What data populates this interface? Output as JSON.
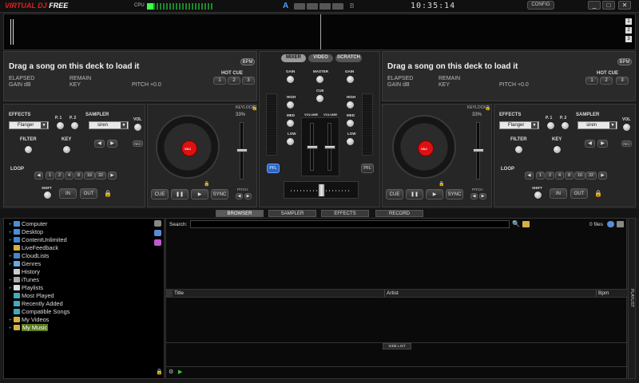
{
  "app": {
    "logo_part1": "VIRTUAL",
    "logo_part2": "DJ",
    "logo_part3": "FREE",
    "cpu_label": "CPU",
    "cpu_load": 0.1,
    "deck_a": "A",
    "deck_b": "B",
    "clock": "10:35:14",
    "config": "CONFIG",
    "min": "_",
    "max": "□",
    "close": "✕"
  },
  "wave": {
    "n1": "1",
    "n2": "2",
    "n3": "3"
  },
  "decks": [
    {
      "title": "Drag a song on this deck to load it",
      "elapsed": "ELAPSED",
      "remain": "REMAIN",
      "gain": "GAIN dB",
      "key": "KEY",
      "pitch": "PITCH +0.0",
      "bpm": "BPM",
      "hotcue": "HOT CUE",
      "hc": [
        "1",
        "2",
        "3"
      ],
      "effects": "EFFECTS",
      "effect_sel": "Flanger",
      "p1": "P. 1",
      "p2": "P. 2",
      "sampler": "SAMPLER",
      "sampler_sel": "siren",
      "vol": "VOL",
      "rec": "REC",
      "filter": "FILTER",
      "key2": "KEY",
      "loop": "LOOP",
      "loops": [
        "◀",
        "1",
        "2",
        "4",
        "8",
        "16",
        "32",
        "▶"
      ],
      "shift": "SHIFT",
      "in": "IN",
      "out": "OUT",
      "keylock": "KEYLOCK",
      "pct": "33%",
      "cue": "CUE",
      "pause": "❚❚",
      "play": "▶",
      "sync": "SYNC",
      "pitch2": "PITCH"
    },
    {
      "title": "Drag a song on this deck to load it",
      "elapsed": "ELAPSED",
      "remain": "REMAIN",
      "gain": "GAIN dB",
      "key": "KEY",
      "pitch": "PITCH +0.0",
      "bpm": "BPM",
      "hotcue": "HOT CUE",
      "hc": [
        "1",
        "2",
        "3"
      ],
      "effects": "EFFECTS",
      "effect_sel": "Flanger",
      "p1": "P. 1",
      "p2": "P. 2",
      "sampler": "SAMPLER",
      "sampler_sel": "siren",
      "vol": "VOL",
      "rec": "REC",
      "filter": "FILTER",
      "key2": "KEY",
      "loop": "LOOP",
      "loops": [
        "◀",
        "1",
        "2",
        "4",
        "8",
        "16",
        "32",
        "▶"
      ],
      "shift": "SHIFT",
      "in": "IN",
      "out": "OUT",
      "keylock": "KEYLOCK",
      "pct": "33%",
      "cue": "CUE",
      "pause": "❚❚",
      "play": "▶",
      "sync": "SYNC",
      "pitch2": "PITCH"
    }
  ],
  "mixer": {
    "tab_mixer": "MIXER",
    "tab_video": "VIDEO",
    "tab_scratch": "SCRATCH",
    "gain": "GAIN",
    "master": "MASTER",
    "cue": "CUE",
    "high": "HIGH",
    "med": "MED",
    "low": "LOW",
    "volume": "VOLUME",
    "pfl": "PFL"
  },
  "tabs": [
    "BROWSER",
    "SAMPLER",
    "EFFECTS",
    "RECORD"
  ],
  "tree": [
    {
      "label": "Computer",
      "plus": "+",
      "color": "#4a8fd6"
    },
    {
      "label": "Desktop",
      "plus": "+",
      "color": "#4a8fd6"
    },
    {
      "label": "ContentUnlimited",
      "plus": "+",
      "color": "#48c"
    },
    {
      "label": "LiveFeedback",
      "plus": "",
      "color": "#d8b040"
    },
    {
      "label": "CloudLists",
      "plus": "+",
      "color": "#48c"
    },
    {
      "label": "Genres",
      "plus": "+",
      "color": "#6ad"
    },
    {
      "label": "History",
      "plus": "",
      "color": "#ccc"
    },
    {
      "label": "iTunes",
      "plus": "+",
      "color": "#aaa"
    },
    {
      "label": "Playlists",
      "plus": "+",
      "color": "#ddd"
    },
    {
      "label": "Most Played",
      "plus": "",
      "color": "#4ab"
    },
    {
      "label": "Recently Added",
      "plus": "",
      "color": "#4ab"
    },
    {
      "label": "Compatible Songs",
      "plus": "",
      "color": "#4ab"
    },
    {
      "label": "My Videos",
      "plus": "+",
      "color": "#d8b040"
    },
    {
      "label": "My Music",
      "plus": "+",
      "color": "#d8b040"
    }
  ],
  "browser": {
    "search_label": "Search:",
    "files": "0 files",
    "cols": [
      "Title",
      "Artist",
      "Bpm"
    ],
    "side_list": "SIDE LIST",
    "playlist_tab": "PLAYLIST"
  }
}
